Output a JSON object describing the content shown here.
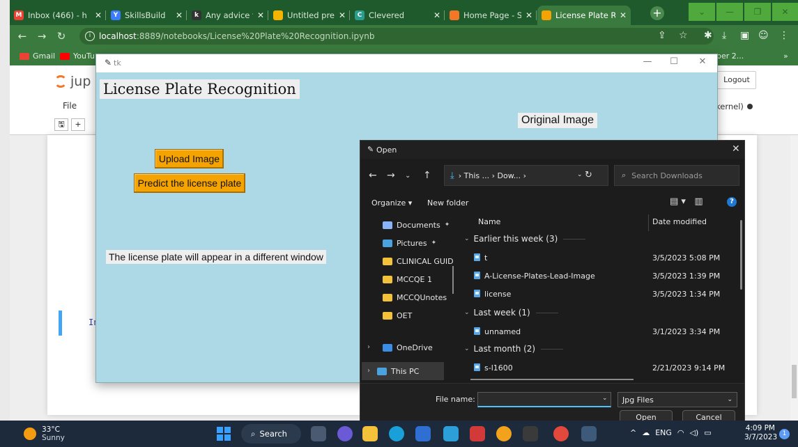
{
  "browser": {
    "tabs": [
      {
        "title": "Inbox (466) - h",
        "favicon": "gmail-icon",
        "color": "#ea4335",
        "glyph": "M"
      },
      {
        "title": "SkillsBuild",
        "favicon": "skillsbuild-icon",
        "color": "#3c7dff",
        "glyph": "Y"
      },
      {
        "title": "Any advice for",
        "favicon": "kijiji-icon",
        "color": "#333333",
        "glyph": "k"
      },
      {
        "title": "Untitled preser",
        "favicon": "slides-icon",
        "color": "#f4b400",
        "glyph": ""
      },
      {
        "title": "Clevered",
        "favicon": "clevered-icon",
        "color": "#2a9d8f",
        "glyph": "C"
      },
      {
        "title": "Home Page - S",
        "favicon": "jupyter-icon",
        "color": "#f37726",
        "glyph": ""
      },
      {
        "title": "License Plate R",
        "favicon": "hourglass-icon",
        "color": "#f5a300",
        "glyph": ""
      }
    ],
    "url_host": "localhost",
    "url_path": ":8889/notebooks/License%20Plate%20Recognition.ipynb",
    "bookmarks": [
      {
        "label": "Gmail",
        "color": "#ea4335"
      },
      {
        "label": "YouTu",
        "color": "#ff0000"
      }
    ],
    "bookmark_overflow": "per 2...",
    "bookmark_more": "»"
  },
  "jupyter": {
    "logo_text": "jup",
    "menu_file": "File",
    "logout": "Logout",
    "kernel_status": "kernel)",
    "cell_prompt": "In"
  },
  "tk_window": {
    "title": "tk",
    "heading": "License Plate Recognition",
    "original_image_label": "Original Image",
    "upload_button": "Upload Image",
    "predict_button": "Predict the license plate",
    "note": "The license plate will appear in a different window",
    "colors": {
      "background": "#add8e6",
      "button": "#f5a300"
    }
  },
  "open_dialog": {
    "title": "Open",
    "address": "› This ... › Dow... ›",
    "search_placeholder": "Search Downloads",
    "organize": "Organize ▾",
    "new_folder": "New folder",
    "sidebar": [
      {
        "label": "Documents",
        "icon": "documents-icon",
        "color": "#8ab4f8",
        "pinned": true
      },
      {
        "label": "Pictures",
        "icon": "pictures-icon",
        "color": "#4aa3df",
        "pinned": true
      },
      {
        "label": "CLINICAL GUID",
        "icon": "folder-icon",
        "color": "#f3c13a",
        "pinned": false
      },
      {
        "label": "MCCQE 1",
        "icon": "folder-icon",
        "color": "#f3c13a",
        "pinned": false
      },
      {
        "label": "MCCQUnotes",
        "icon": "folder-icon",
        "color": "#f3c13a",
        "pinned": false
      },
      {
        "label": "OET",
        "icon": "folder-icon",
        "color": "#f3c13a",
        "pinned": false
      },
      {
        "label": "OneDrive",
        "icon": "onedrive-icon",
        "color": "#3a8ee6",
        "pinned": false
      },
      {
        "label": "This PC",
        "icon": "this-pc-icon",
        "color": "#4aa3df",
        "pinned": false
      }
    ],
    "columns": {
      "name": "Name",
      "date": "Date modified"
    },
    "groups": [
      {
        "label": "Earlier this week (3)",
        "files": [
          {
            "name": "t",
            "date": "3/5/2023 5:08 PM"
          },
          {
            "name": "A-License-Plates-Lead-Image",
            "date": "3/5/2023 1:39 PM"
          },
          {
            "name": "license",
            "date": "3/5/2023 1:34 PM"
          }
        ]
      },
      {
        "label": "Last week (1)",
        "files": [
          {
            "name": "unnamed",
            "date": "3/1/2023 3:34 PM"
          }
        ]
      },
      {
        "label": "Last month (2)",
        "files": [
          {
            "name": "s-l1600",
            "date": "2/21/2023 9:14 PM"
          }
        ]
      }
    ],
    "file_name_label": "File name:",
    "file_name_value": "",
    "file_type": "Jpg Files",
    "open_button": "Open",
    "cancel_button": "Cancel"
  },
  "taskbar": {
    "temperature": "33°C",
    "weather": "Sunny",
    "search": "Search",
    "language": "ENG",
    "time": "4:09 PM",
    "date": "3/7/2023",
    "notification_count": "1"
  }
}
